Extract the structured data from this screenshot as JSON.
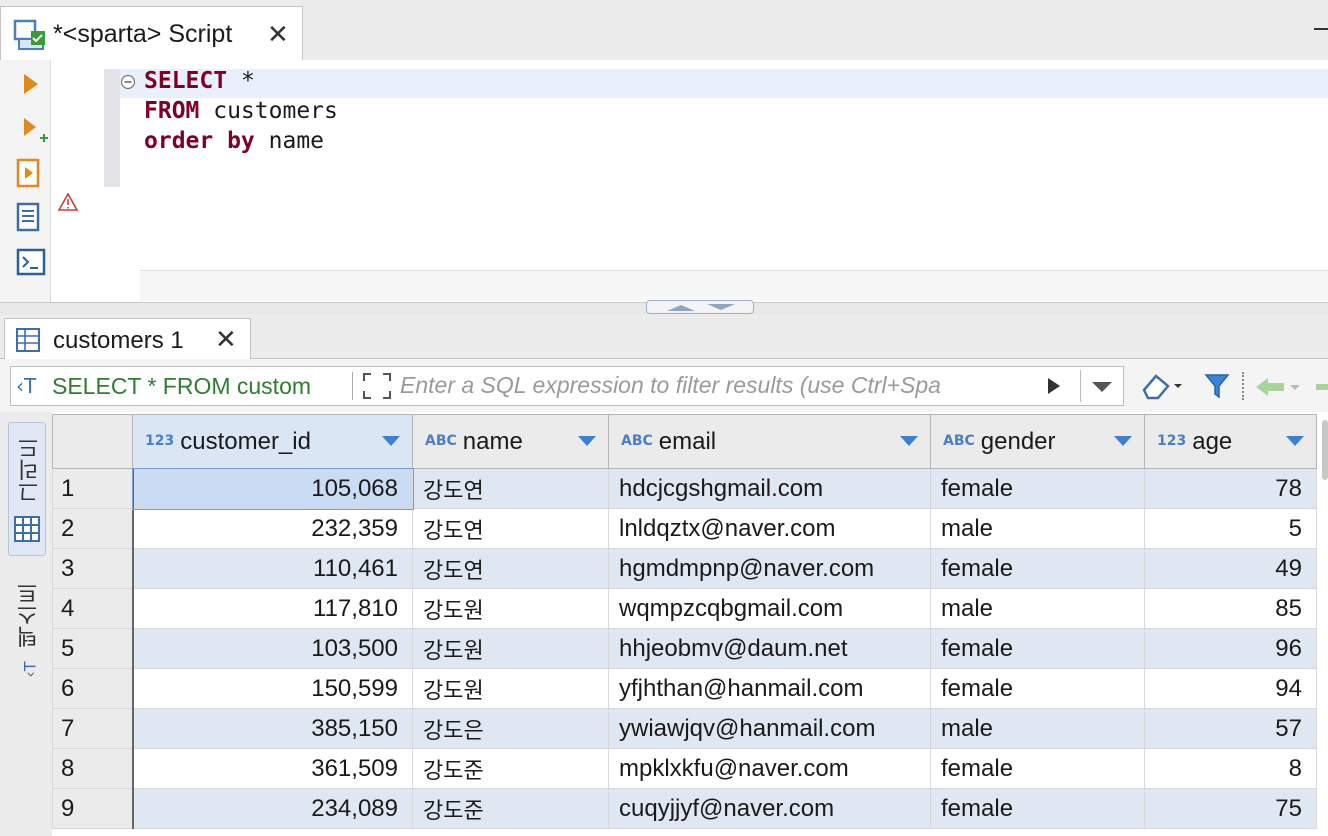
{
  "editor_tab": {
    "title": "*<sparta> Script",
    "close": "✕"
  },
  "sql": {
    "lines": [
      {
        "kw": "SELECT",
        "rest": " *"
      },
      {
        "kw": "FROM",
        "rest": " customers"
      },
      {
        "kw": "order by",
        "rest": " name"
      }
    ]
  },
  "results_tab": {
    "title": "customers 1",
    "close": "✕"
  },
  "filter": {
    "sql_text": "SELECT * FROM custom",
    "placeholder": "Enter a SQL expression to filter results (use Ctrl+Spa"
  },
  "side_panel": {
    "grid_label": "그리드",
    "text_label": "텍스트"
  },
  "grid": {
    "columns": [
      {
        "type": "123",
        "name": "customer_id"
      },
      {
        "type": "ABC",
        "name": "name"
      },
      {
        "type": "ABC",
        "name": "email"
      },
      {
        "type": "ABC",
        "name": "gender"
      },
      {
        "type": "123",
        "name": "age"
      }
    ],
    "rows": [
      {
        "n": "1",
        "id": "105,068",
        "name": "강도연",
        "email": "hdcjcgshgmail.com",
        "gender": "female",
        "age": "78"
      },
      {
        "n": "2",
        "id": "232,359",
        "name": "강도연",
        "email": "lnldqztx@naver.com",
        "gender": "male",
        "age": "5"
      },
      {
        "n": "3",
        "id": "110,461",
        "name": "강도연",
        "email": "hgmdmpnp@naver.com",
        "gender": "female",
        "age": "49"
      },
      {
        "n": "4",
        "id": "117,810",
        "name": "강도원",
        "email": "wqmpzcqbgmail.com",
        "gender": "male",
        "age": "85"
      },
      {
        "n": "5",
        "id": "103,500",
        "name": "강도원",
        "email": "hhjeobmv@daum.net",
        "gender": "female",
        "age": "96"
      },
      {
        "n": "6",
        "id": "150,599",
        "name": "강도원",
        "email": "yfjhthan@hanmail.com",
        "gender": "female",
        "age": "94"
      },
      {
        "n": "7",
        "id": "385,150",
        "name": "강도은",
        "email": "ywiawjqv@hanmail.com",
        "gender": "male",
        "age": "57"
      },
      {
        "n": "8",
        "id": "361,509",
        "name": "강도준",
        "email": "mpklxkfu@naver.com",
        "gender": "female",
        "age": "8"
      },
      {
        "n": "9",
        "id": "234,089",
        "name": "강도준",
        "email": "cuqyjjyf@naver.com",
        "gender": "female",
        "age": "75"
      }
    ]
  }
}
